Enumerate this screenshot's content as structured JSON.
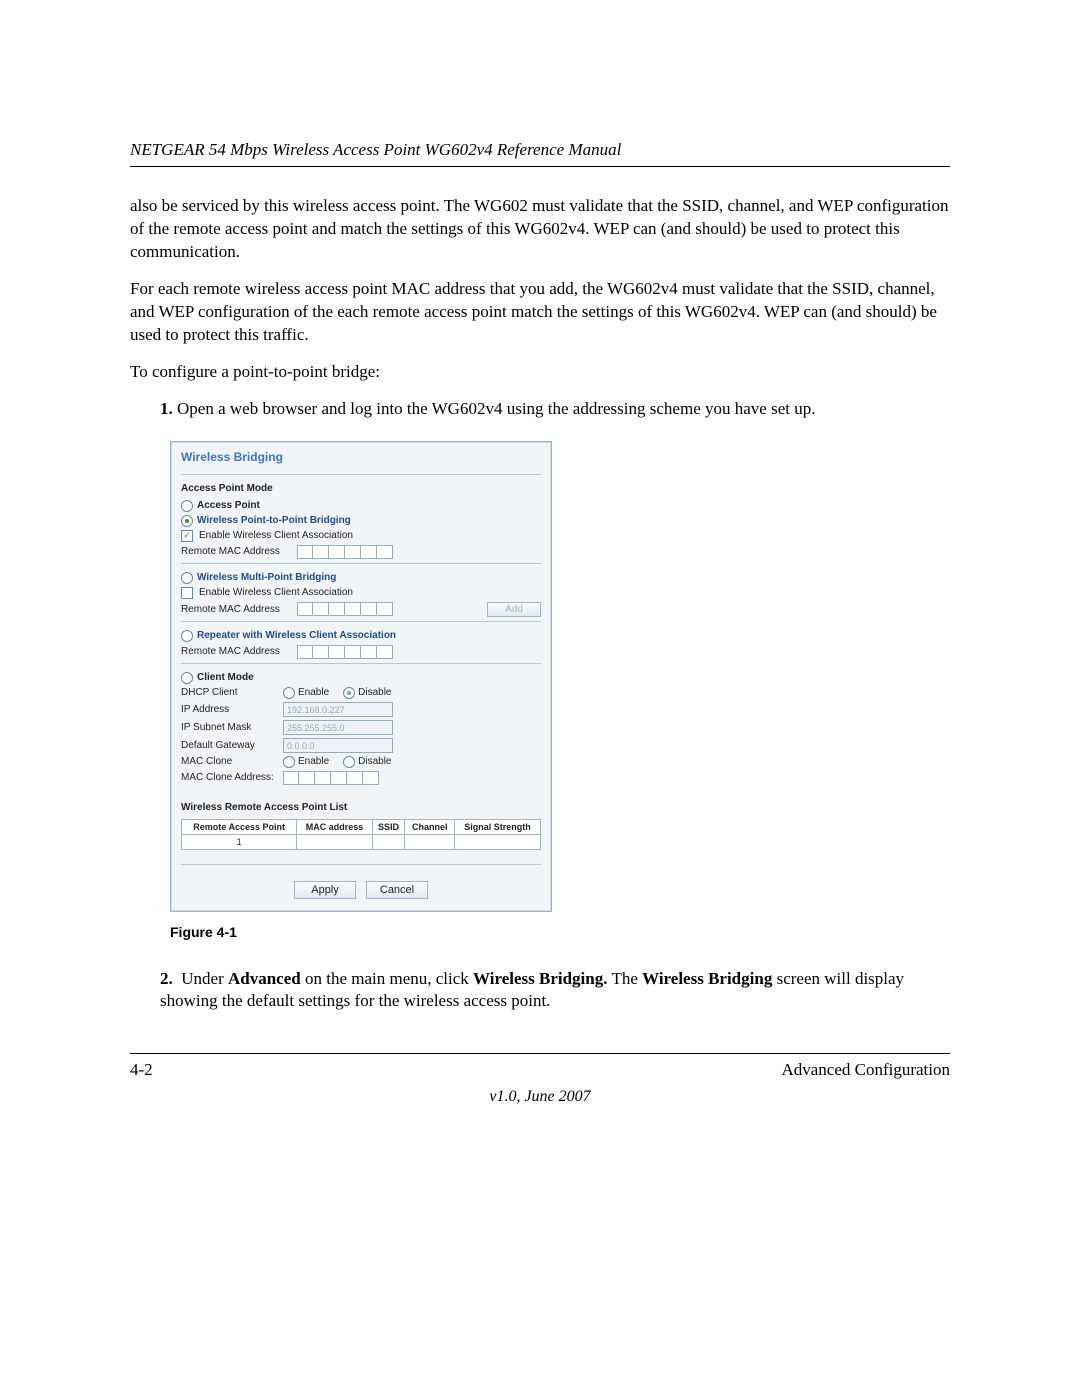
{
  "header": {
    "title": "NETGEAR 54 Mbps Wireless Access Point WG602v4 Reference Manual"
  },
  "body": {
    "p1": "also be serviced by this wireless access point. The WG602 must validate that the SSID, channel, and WEP configuration of the remote access point and match the settings of this WG602v4. WEP can (and should) be used to protect this communication.",
    "p2": "For each remote wireless access point MAC address that you add, the WG602v4 must validate that the SSID, channel, and WEP configuration of the each remote access point match the settings of this WG602v4. WEP can (and should) be used to protect this traffic.",
    "p3": "To configure a point-to-point bridge:",
    "li1": "Open a web browser and log into the WG602v4 using the addressing scheme you have set up.",
    "li2_a": "Under ",
    "li2_b": "Advanced",
    "li2_c": " on the main menu, click ",
    "li2_d": "Wireless Bridging.",
    "li2_e": " The ",
    "li2_f": "Wireless Bridging",
    "li2_g": " screen will display showing the default settings for the wireless access point."
  },
  "figure": {
    "caption": "Figure 4-1",
    "panel": {
      "title": "Wireless Bridging",
      "section1": "Access Point Mode",
      "opt_ap": "Access Point",
      "opt_ptp": "Wireless Point-to-Point Bridging",
      "chk_assoc": "Enable Wireless Client Association",
      "remote_mac": "Remote MAC Address",
      "opt_mp": "Wireless Multi-Point Bridging",
      "add": "Add",
      "opt_rep": "Repeater with Wireless Client Association",
      "opt_client": "Client Mode",
      "dhcp": "DHCP Client",
      "enable": "Enable",
      "disable": "Disable",
      "ip_addr": "IP Address",
      "ip_addr_val": "192.168.0.227",
      "subnet": "IP Subnet Mask",
      "subnet_val": "255.255.255.0",
      "gateway": "Default Gateway",
      "gateway_val": "0.0.0.0",
      "mac_clone": "MAC Clone",
      "mac_clone_addr": "MAC Clone Address:",
      "list_title": "Wireless Remote Access Point List",
      "th1": "Remote Access Point",
      "th2": "MAC address",
      "th3": "SSID",
      "th4": "Channel",
      "th5": "Signal Strength",
      "row1": "1",
      "apply": "Apply",
      "cancel": "Cancel"
    }
  },
  "footer": {
    "page": "4-2",
    "section": "Advanced Configuration",
    "version": "v1.0, June 2007"
  }
}
